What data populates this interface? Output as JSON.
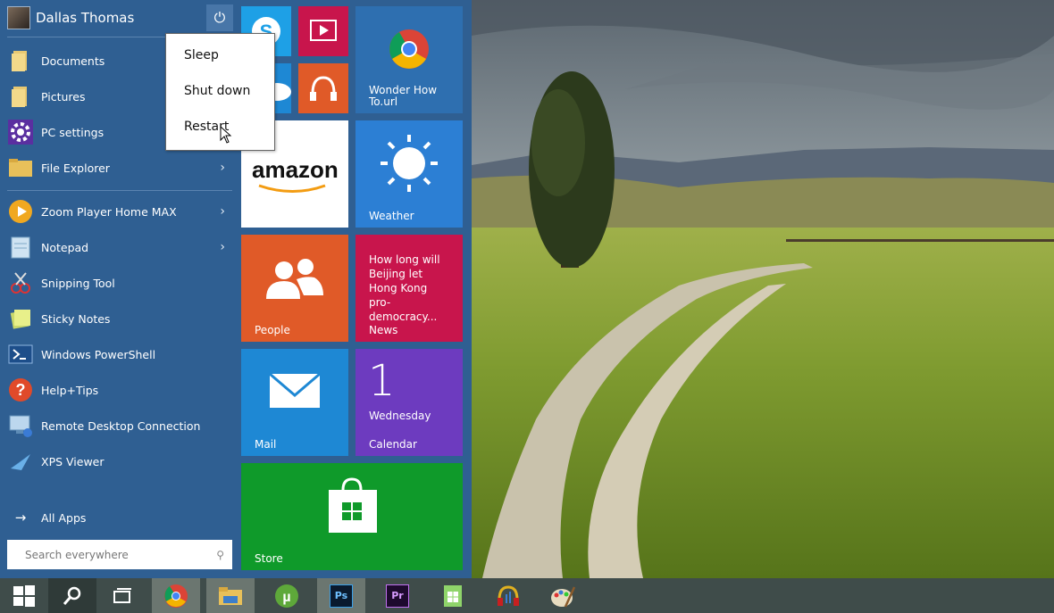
{
  "user": {
    "name": "Dallas Thomas"
  },
  "places": [
    {
      "label": "Documents",
      "icon": "folder-icon"
    },
    {
      "label": "Pictures",
      "icon": "folder-icon"
    },
    {
      "label": "PC settings",
      "icon": "gear-icon"
    },
    {
      "label": "File Explorer",
      "icon": "folder-icon"
    }
  ],
  "apps": [
    {
      "label": "Zoom Player Home MAX",
      "icon": "zoom-player-icon"
    },
    {
      "label": "Notepad",
      "icon": "notepad-icon"
    },
    {
      "label": "Snipping Tool",
      "icon": "scissors-icon"
    },
    {
      "label": "Sticky Notes",
      "icon": "sticky-notes-icon"
    },
    {
      "label": "Windows PowerShell",
      "icon": "powershell-icon"
    },
    {
      "label": "Help+Tips",
      "icon": "question-icon"
    },
    {
      "label": "Remote Desktop Connection",
      "icon": "remote-desktop-icon"
    },
    {
      "label": "XPS Viewer",
      "icon": "xps-viewer-icon"
    }
  ],
  "all_apps": {
    "label": "All Apps"
  },
  "search": {
    "placeholder": "Search everywhere"
  },
  "power_menu": {
    "items": [
      "Sleep",
      "Shut down",
      "Restart"
    ]
  },
  "tiles": {
    "wonder_how": {
      "label": "Wonder How To.url"
    },
    "amazon": {
      "text": "amazon"
    },
    "weather": {
      "label": "Weather"
    },
    "people": {
      "label": "People"
    },
    "news": {
      "label": "News",
      "headline": "How long will Beijing let Hong Kong pro-democracy..."
    },
    "mail": {
      "label": "Mail"
    },
    "calendar": {
      "label": "Calendar",
      "day": "1",
      "weekday": "Wednesday"
    },
    "store": {
      "label": "Store"
    }
  },
  "taskbar": {
    "icons": [
      "windows-start-icon",
      "search-icon",
      "task-view-icon",
      "chrome-icon",
      "file-explorer-icon",
      "utorrent-icon",
      "photoshop-icon",
      "premiere-icon",
      "sheets-icon",
      "headphones-app-icon",
      "paint-icon"
    ],
    "ps_text": "Ps",
    "pr_text": "Pr"
  },
  "colors": {
    "start_bg": "#2f5f92",
    "people_tile": "#e05a28",
    "news_tile": "#c8154c",
    "mail_tile": "#1e88d4",
    "calendar_tile": "#6d3bbf",
    "store_tile": "#0f9a2a",
    "weather_tile": "#2c7fd4"
  }
}
